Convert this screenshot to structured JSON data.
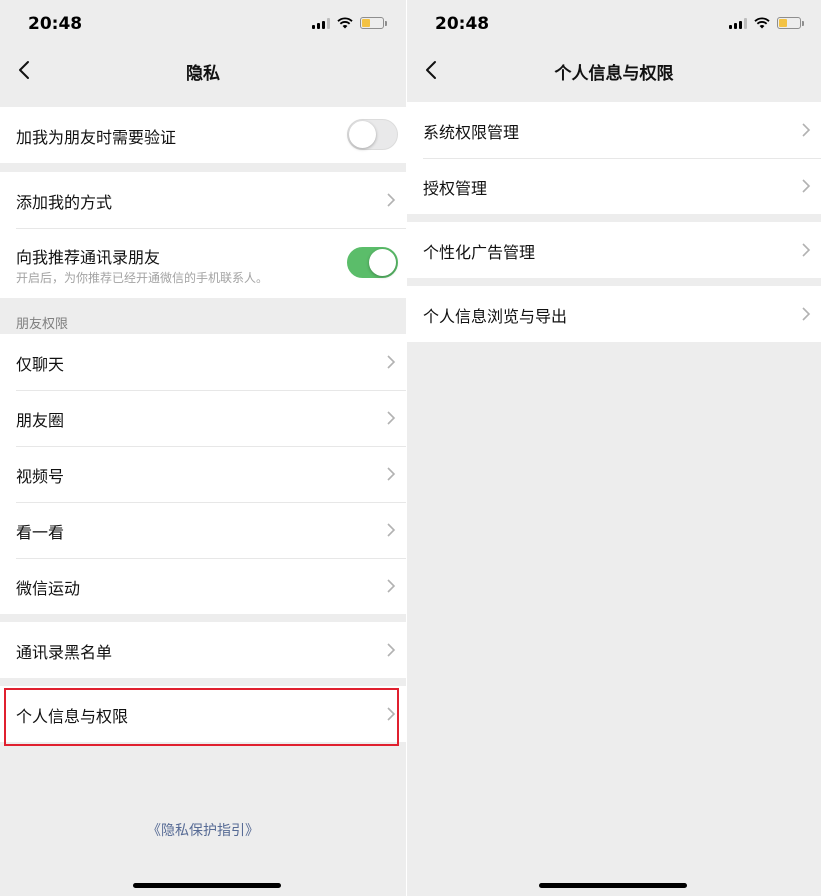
{
  "status_bar": {
    "time": "20:48"
  },
  "left_screen": {
    "title": "隐私",
    "group1": {
      "verify_friend": {
        "label": "加我为朋友时需要验证",
        "on": false
      }
    },
    "group2": {
      "add_methods": {
        "label": "添加我的方式"
      },
      "recommend_contacts": {
        "label": "向我推荐通讯录朋友",
        "sub": "开启后，为你推荐已经开通微信的手机联系人。",
        "on": true
      }
    },
    "friend_permissions_header": "朋友权限",
    "friend_permissions": [
      {
        "label": "仅聊天"
      },
      {
        "label": "朋友圈"
      },
      {
        "label": "视频号"
      },
      {
        "label": "看一看"
      },
      {
        "label": "微信运动"
      }
    ],
    "blacklist": {
      "label": "通讯录黑名单"
    },
    "personal_info": {
      "label": "个人信息与权限"
    },
    "footer_link": "《隐私保护指引》"
  },
  "right_screen": {
    "title": "个人信息与权限",
    "group1": [
      {
        "label": "系统权限管理"
      },
      {
        "label": "授权管理"
      }
    ],
    "group2": [
      {
        "label": "个性化广告管理"
      }
    ],
    "group3": [
      {
        "label": "个人信息浏览与导出"
      }
    ]
  },
  "colors": {
    "background": "#ededed",
    "toggle_on": "#5bbd6a",
    "link": "#576b95",
    "highlight": "#e0202f",
    "battery_fill": "#f3c243"
  }
}
